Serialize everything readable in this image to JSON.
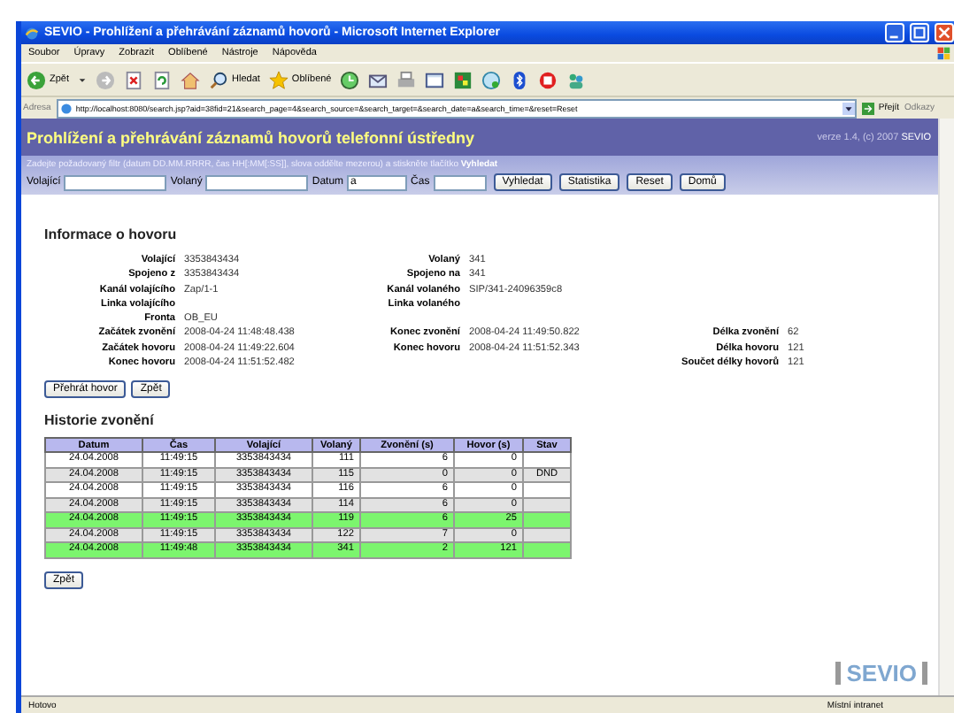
{
  "window": {
    "title": "SEVIO - Prohlížení a přehrávání záznamů hovorů - Microsoft Internet Explorer"
  },
  "menu": [
    "Soubor",
    "Úpravy",
    "Zobrazit",
    "Oblíbené",
    "Nástroje",
    "Nápověda"
  ],
  "toolbar": {
    "back": "Zpět",
    "search": "Hledat",
    "favorites": "Oblíbené"
  },
  "address": {
    "label": "Adresa",
    "url": "http://localhost:8080/search.jsp?aid=38fid=21&search_page=4&search_source=&search_target=&search_date=a&search_time=&reset=Reset",
    "go": "Přejít",
    "links": "Odkazy"
  },
  "header": {
    "title": "Prohlížení a přehrávání záznamů hovorů telefonní ústředny",
    "version": "verze 1.4, (c) 2007",
    "brand": "SEVIO"
  },
  "filter": {
    "hint": "Zadejte požadovaný filtr (datum DD.MM.RRRR, čas HH[:MM[:SS]], slova oddělte mezerou) a stiskněte tlačítko **Vyhledat**",
    "fields": [
      {
        "label": "Volající"
      },
      {
        "label": "Volaný"
      },
      {
        "label": "Datum",
        "value": "a"
      },
      {
        "label": "Čas"
      }
    ],
    "buttons": [
      "Vyhledat",
      "Statistika",
      "Reset",
      "Domů"
    ]
  },
  "info": {
    "title": "Informace o hovoru",
    "rows": [
      [
        {
          "label": "Volající",
          "value": "3353843434"
        },
        {
          "label": "Volaný",
          "value": "341"
        },
        null
      ],
      [
        {
          "label": "Spojeno z",
          "value": "3353843434"
        },
        {
          "label": "Spojeno na",
          "value": "341"
        },
        null
      ],
      [
        {
          "label": "Kanál volajícího",
          "value": "Zap/1-1"
        },
        {
          "label": "Kanál volaného",
          "value": "SIP/341-24096359c8"
        },
        null
      ],
      [
        {
          "label": "Linka volajícího"
        },
        {
          "label": "Linka volaného"
        },
        null
      ],
      [
        {
          "label": "Fronta",
          "value": "OB_EU"
        },
        null,
        null
      ],
      [
        {
          "label": "Začátek zvonění",
          "value": "2008-04-24 11:48:48.438"
        },
        {
          "label": "Konec zvonění",
          "value": "2008-04-24 11:49:50.822"
        },
        {
          "label": "Délka zvonění",
          "value": "62"
        }
      ],
      [
        {
          "label": "Začátek hovoru",
          "value": "2008-04-24 11:49:22.604"
        },
        {
          "label": "Konec hovoru",
          "value": "2008-04-24 11:51:52.343"
        },
        {
          "label": "Délka hovoru",
          "value": "121"
        }
      ],
      [
        {
          "label": "Konec hovoru",
          "value": "2008-04-24 11:51:52.482"
        },
        null,
        {
          "label": "Součet délky hovorů",
          "value": "121"
        }
      ]
    ],
    "buttons": [
      "Přehrát hovor",
      "Zpět"
    ]
  },
  "history": {
    "title": "Historie zvonění",
    "columns": [
      "Datum",
      "Čas",
      "Volající",
      "Volaný",
      "Zvonění (s)",
      "Hovor (s)",
      "Stav"
    ],
    "rows": [
      {
        "cells": [
          "24.04.2008",
          "11:49:15",
          "3353843434",
          "111",
          "6",
          "0",
          ""
        ],
        "highlighted": false
      },
      {
        "cells": [
          "24.04.2008",
          "11:49:15",
          "3353843434",
          "115",
          "0",
          "0",
          "DND"
        ],
        "highlighted": false
      },
      {
        "cells": [
          "24.04.2008",
          "11:49:15",
          "3353843434",
          "116",
          "6",
          "0",
          ""
        ],
        "highlighted": false
      },
      {
        "cells": [
          "24.04.2008",
          "11:49:15",
          "3353843434",
          "114",
          "6",
          "0",
          ""
        ],
        "highlighted": false
      },
      {
        "cells": [
          "24.04.2008",
          "11:49:15",
          "3353843434",
          "119",
          "6",
          "25",
          ""
        ],
        "highlighted": true
      },
      {
        "cells": [
          "24.04.2008",
          "11:49:15",
          "3353843434",
          "122",
          "7",
          "0",
          ""
        ],
        "highlighted": false
      },
      {
        "cells": [
          "24.04.2008",
          "11:49:48",
          "3353843434",
          "341",
          "2",
          "121",
          ""
        ],
        "highlighted": true
      }
    ],
    "back": "Zpět"
  },
  "logo": "SEVIO",
  "status_bar": {
    "text": "Hotovo",
    "zone": "Místní intranet"
  }
}
